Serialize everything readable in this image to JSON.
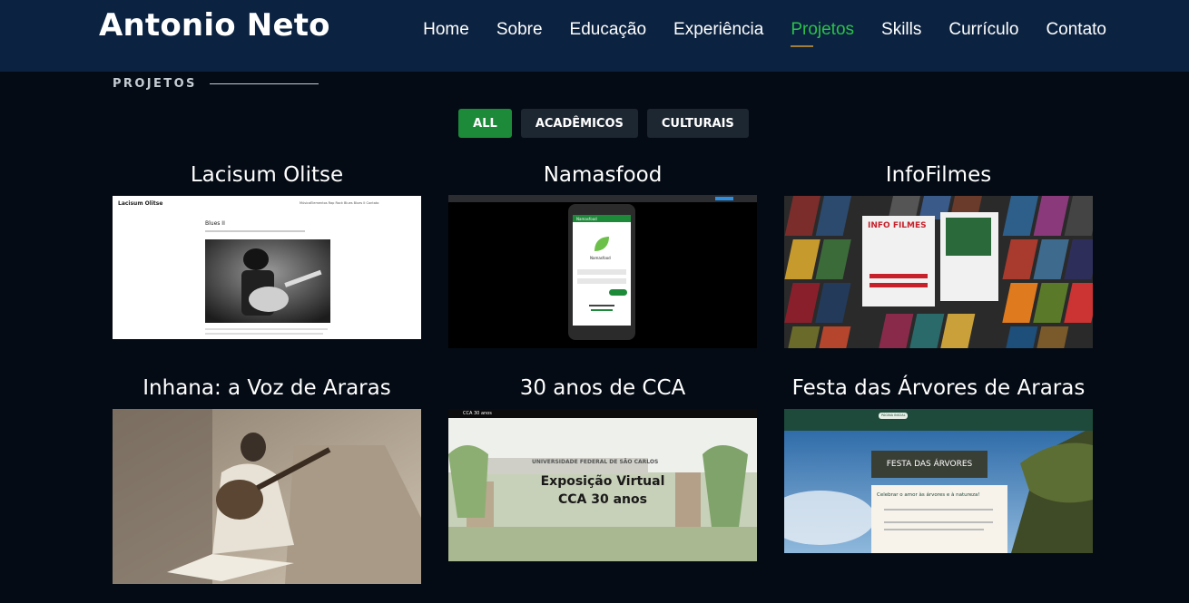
{
  "header": {
    "logo": "Antonio Neto",
    "nav": [
      "Home",
      "Sobre",
      "Educação",
      "Experiência",
      "Projetos",
      "Skills",
      "Currículo",
      "Contato"
    ],
    "active_nav": "Projetos"
  },
  "section": {
    "title": "PROJETOS"
  },
  "filters": {
    "all": "ALL",
    "academic": "ACADÊMICOS",
    "cultural": "CULTURAIS",
    "active": "ALL"
  },
  "projects": [
    {
      "title": "Lacisum Olitse",
      "thumb": {
        "site_name": "Lacisum Olitse",
        "post_title": "Blues II",
        "menu": "MúsicaElementos Rap Rock Blues Blues II Contato"
      }
    },
    {
      "title": "Namasfood",
      "thumb": {
        "app_name": "Namasfood"
      }
    },
    {
      "title": "InfoFilmes",
      "thumb": {
        "banner": "INFO FILMES"
      }
    },
    {
      "title": "Inhana: a Voz de Araras"
    },
    {
      "title": "30 anos de CCA",
      "thumb": {
        "tab": "CCA 30 anos",
        "sign": "UNIVERSIDADE FEDERAL DE SÃO CARLOS",
        "headline_1": "Exposição Virtual",
        "headline_2": "CCA 30 anos"
      }
    },
    {
      "title": "Festa das Árvores de Araras",
      "thumb": {
        "banner": "FESTA DAS ÁRVORES",
        "tagline": "Celebrar o amor às árvores e à natureza!",
        "menu_home": "PÁGINA INICIAL"
      }
    }
  ],
  "colors": {
    "header_bg": "#0b2240",
    "page_bg": "#040b14",
    "accent_green": "#2bc24a",
    "filter_active": "#1d8a3a"
  }
}
